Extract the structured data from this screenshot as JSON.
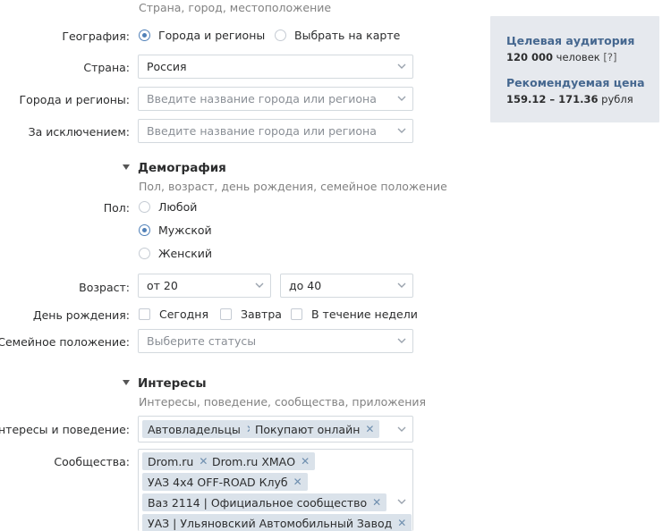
{
  "geo": {
    "hint": "Страна, город, местоположение",
    "geography_label": "География:",
    "geography_options": [
      "Города и регионы",
      "Выбрать на карте"
    ],
    "country_label": "Страна:",
    "country_value": "Россия",
    "cities_label": "Города и регионы:",
    "cities_placeholder": "Введите название города или региона",
    "except_label": "За исключением:",
    "except_placeholder": "Введите название города или региона"
  },
  "demography": {
    "title": "Демография",
    "hint": "Пол, возраст, день рождения, семейное положение",
    "gender_label": "Пол:",
    "gender_options": [
      "Любой",
      "Мужской",
      "Женский"
    ],
    "gender_selected": "Мужской",
    "age_label": "Возраст:",
    "age_from": "от 20",
    "age_to": "до 40",
    "birthday_label": "День рождения:",
    "birthday_options": [
      "Сегодня",
      "Завтра",
      "В течение недели"
    ],
    "marital_label": "Семейное положение:",
    "marital_placeholder": "Выберите статусы"
  },
  "interests": {
    "title": "Интересы",
    "hint": "Интересы, поведение, сообщества, приложения",
    "behavior_label": "Интересы и поведение:",
    "behavior_tags": [
      "Автовладельцы",
      "Покупают онлайн"
    ],
    "communities_label": "Сообщества:",
    "community_tags": [
      "Drom.ru",
      "Drom.ru ХМАО",
      "УАЗ 4x4 OFF-ROAD Клуб",
      "Ваз 2114 | Официальное сообщество",
      "УАЗ | Ульяновский Автомобильный Завод"
    ],
    "remove_glyph": "✕"
  },
  "sidebar": {
    "audience_title": "Целевая аудитория",
    "audience_count": "120 000",
    "audience_unit": "человек",
    "audience_help": "[?]",
    "price_title": "Рекомендуемая цена",
    "price_range": "159.12 – 171.36",
    "price_unit": "рубля"
  },
  "colors": {
    "accent": "#5181b8",
    "sidebar_bg": "#e6e9ee",
    "sidebar_heading": "#45678f",
    "tag_bg": "#dae2ea"
  }
}
